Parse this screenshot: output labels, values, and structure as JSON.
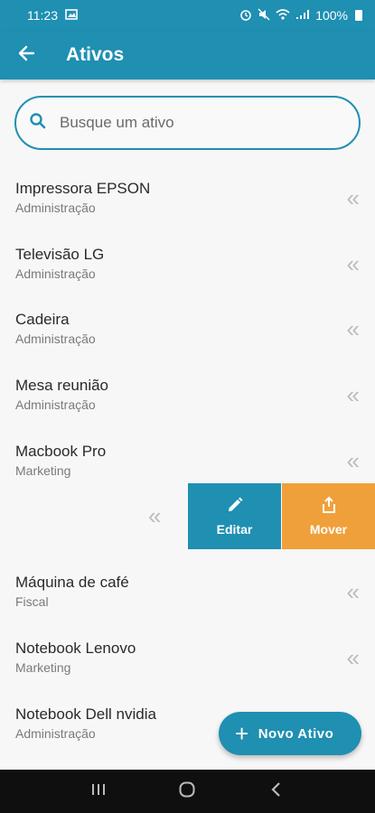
{
  "status_bar": {
    "time": "11:23",
    "battery": "100%"
  },
  "app_bar": {
    "title": "Ativos"
  },
  "search": {
    "placeholder": "Busque um ativo",
    "value": ""
  },
  "assets": [
    {
      "name": "Impressora EPSON",
      "department": "Administração"
    },
    {
      "name": "Televisão LG",
      "department": "Administração"
    },
    {
      "name": "Cadeira",
      "department": "Administração"
    },
    {
      "name": "Mesa reunião",
      "department": "Administração"
    },
    {
      "name": "Macbook Pro",
      "department": "Marketing"
    },
    {
      "name": "Máquina de café",
      "department": "Fiscal"
    },
    {
      "name": "Notebook Lenovo",
      "department": "Marketing"
    },
    {
      "name": "Notebook Dell nvidia",
      "department": "Administração"
    }
  ],
  "swipe_actions": {
    "edit_label": "Editar",
    "move_label": "Mover"
  },
  "fab": {
    "label": "Novo Ativo"
  },
  "colors": {
    "primary": "#1f8fb2",
    "move_action": "#f0a03a",
    "chevron": "#bdbdbd"
  },
  "icons": {
    "back": "arrow-left-icon",
    "search": "search-icon",
    "edit": "pencil-icon",
    "move": "share-icon",
    "chevron": "double-chevron-left-icon"
  }
}
